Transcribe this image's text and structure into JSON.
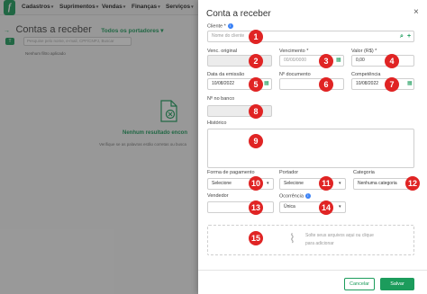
{
  "topbar": {
    "logo": "f",
    "menu": [
      "Cadastros",
      "Suprimentos",
      "Vendas",
      "Finanças",
      "Serviços"
    ]
  },
  "background": {
    "arrow": "→",
    "title": "Contas a receber",
    "portadores": "Todos os portadores",
    "search_placeholder": "Pesquise pelo nome, e-mail, CPF/CNPJ, Buscar",
    "no_filter": "Nenhum filtro aplicado",
    "empty_title": "Nenhum resultado encon",
    "empty_sub": "Verifique se as palavras estão corretas ou busca"
  },
  "modal": {
    "title": "Conta a receber",
    "close": "×",
    "cliente": {
      "label": "Cliente *",
      "placeholder": "Nome do cliente"
    },
    "venc_original": {
      "label": "Venc. original",
      "value": ""
    },
    "vencimento": {
      "label": "Vencimento *",
      "placeholder": "00/00/0000"
    },
    "valor": {
      "label": "Valor (R$) *",
      "value": "0,00"
    },
    "data_emissao": {
      "label": "Data da emissão",
      "value": "10/08/2022"
    },
    "num_documento": {
      "label": "Nº documento",
      "value": ""
    },
    "competencia": {
      "label": "Competência",
      "value": "10/08/2022"
    },
    "num_banco": {
      "label": "Nº no banco",
      "value": ""
    },
    "historico": {
      "label": "Histórico"
    },
    "forma_pagamento": {
      "label": "Forma de pagamento",
      "value": "Selecione"
    },
    "portador": {
      "label": "Portador",
      "value": "Selecione"
    },
    "categoria": {
      "label": "Categoria",
      "value": "Nenhuma categoria"
    },
    "vendedor": {
      "label": "Vendedor",
      "value": ""
    },
    "ocorrencia": {
      "label": "Ocorrência",
      "value": "Única"
    },
    "dropzone": {
      "text": "Solte seus arquivos aqui ou clique para adicionar"
    },
    "cancel_label": "Cancelar",
    "save_label": "Salvar"
  },
  "badges": [
    "1",
    "2",
    "3",
    "4",
    "5",
    "6",
    "7",
    "8",
    "9",
    "10",
    "11",
    "12",
    "13",
    "14",
    "15"
  ],
  "colors": {
    "brand": "#1c9c5c",
    "badge": "#e02424",
    "info": "#3b82f6"
  }
}
